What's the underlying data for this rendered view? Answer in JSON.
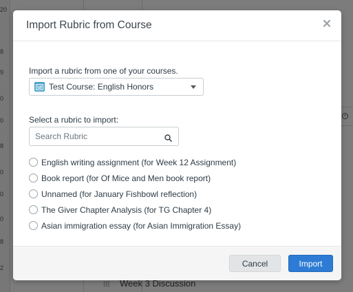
{
  "background": {
    "left_numbers": [
      "20",
      "8",
      "9",
      "0",
      "0",
      "8",
      "0",
      "0",
      "0",
      "8",
      "2"
    ],
    "bottom_row_label": "Week 3 Discussion"
  },
  "modal": {
    "title": "Import Rubric from Course",
    "close_icon": "close-x-icon",
    "intro_text": "Import a rubric from one of your courses.",
    "course_select": {
      "selected": "Test Course: English Honors",
      "icon": "course-icon",
      "accent": "#4ba3c9"
    },
    "select_rubric_label": "Select a rubric to import:",
    "search": {
      "placeholder": "Search Rubric",
      "value": ""
    },
    "rubrics": [
      {
        "label": "English writing assignment (for Week 12 Assignment)"
      },
      {
        "label": "Book report (for Of Mice and Men book report)"
      },
      {
        "label": "Unnamed (for January Fishbowl reflection)"
      },
      {
        "label": "The Giver Chapter Analysis (for TG Chapter 4)"
      },
      {
        "label": "Asian immigration essay (for Asian Immigration Essay)"
      }
    ],
    "footer": {
      "cancel_label": "Cancel",
      "import_label": "Import",
      "import_color": "#2d7bd4"
    }
  }
}
